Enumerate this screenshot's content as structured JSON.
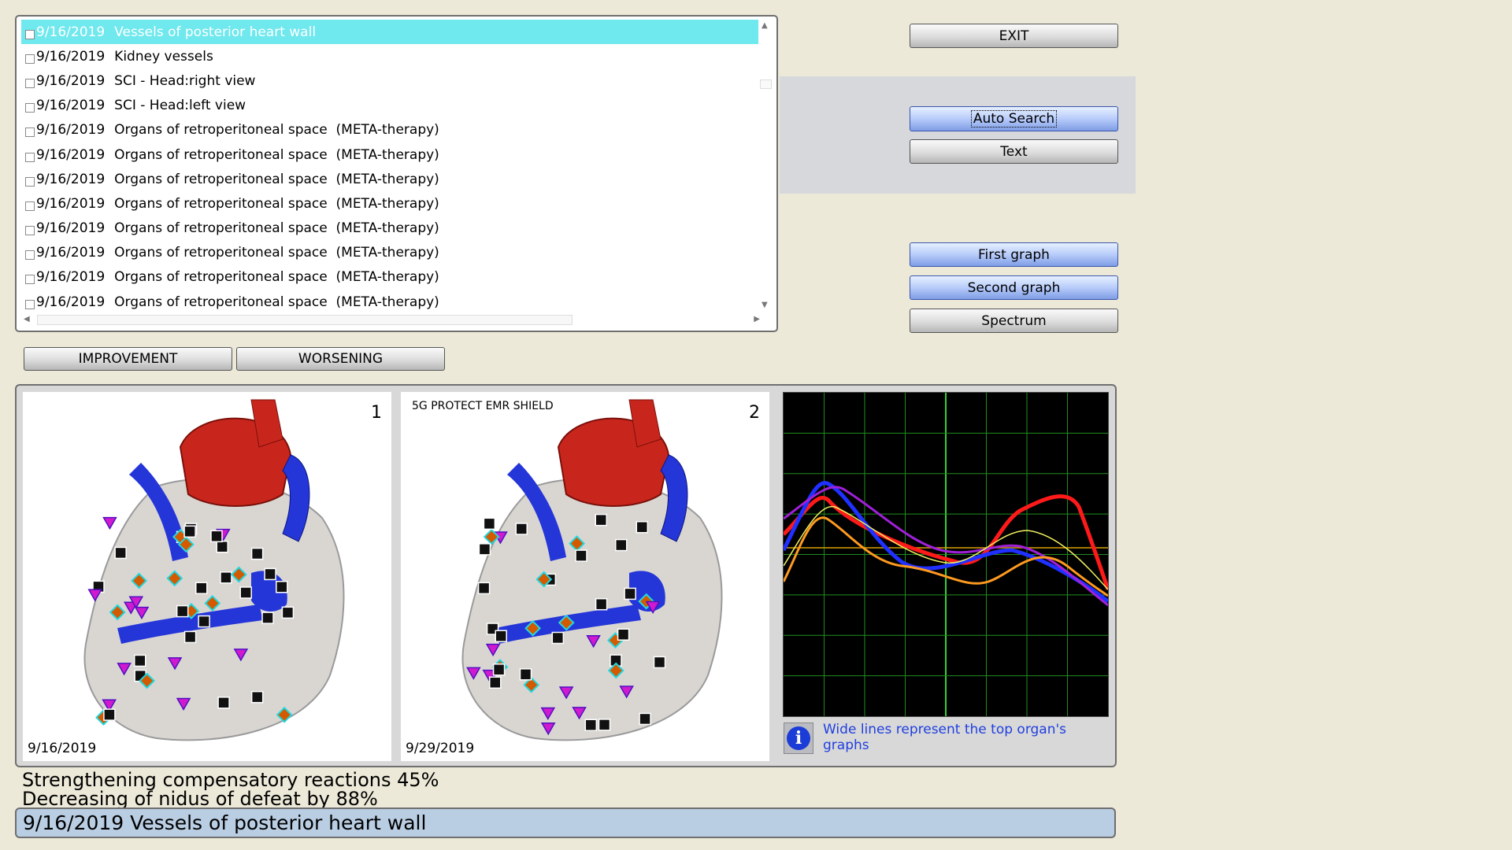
{
  "session_list": {
    "items": [
      {
        "date": "9/16/2019",
        "name": "Vessels of posterior heart wall",
        "selected": true
      },
      {
        "date": "9/16/2019",
        "name": "Kidney vessels"
      },
      {
        "date": "9/16/2019",
        "name": "SCI - Head:right view"
      },
      {
        "date": "9/16/2019",
        "name": "SCI - Head:left view"
      },
      {
        "date": "9/16/2019",
        "name": "Organs of retroperitoneal space  (META-therapy)"
      },
      {
        "date": "9/16/2019",
        "name": "Organs of retroperitoneal space  (META-therapy)"
      },
      {
        "date": "9/16/2019",
        "name": "Organs of retroperitoneal space  (META-therapy)"
      },
      {
        "date": "9/16/2019",
        "name": "Organs of retroperitoneal space  (META-therapy)"
      },
      {
        "date": "9/16/2019",
        "name": "Organs of retroperitoneal space  (META-therapy)"
      },
      {
        "date": "9/16/2019",
        "name": "Organs of retroperitoneal space  (META-therapy)"
      },
      {
        "date": "9/16/2019",
        "name": "Organs of retroperitoneal space  (META-therapy)"
      },
      {
        "date": "9/16/2019",
        "name": "Organs of retroperitoneal space  (META-therapy)"
      }
    ]
  },
  "buttons": {
    "exit": "EXIT",
    "auto_search": "Auto Search",
    "text": "Text",
    "first_graph": "First graph",
    "second_graph": "Second graph",
    "spectrum": "Spectrum",
    "improvement": "IMPROVEMENT",
    "worsening": "WORSENING"
  },
  "images": {
    "first": {
      "number": "1",
      "date": "9/16/2019"
    },
    "second": {
      "number": "2",
      "date": "9/29/2019",
      "caption": "5G PROTECT EMR SHIELD"
    }
  },
  "graph": {
    "info_text": "Wide lines represent the top organ's graphs",
    "colors": {
      "background": "#000000",
      "grid": "#1f8f1f",
      "center": "#38d038",
      "baseline": "#d8a000"
    },
    "series_colors": [
      "#ff1a1a",
      "#2030ff",
      "#a020d8",
      "#ff9a20",
      "#f0f060"
    ]
  },
  "results": {
    "line1": "Strengthening compensatory reactions 45%",
    "line2": "Decreasing of nidus of defeat by 88%"
  },
  "status": {
    "text": "9/16/2019 Vessels of posterior heart wall"
  },
  "colors": {
    "window_bg": "#ece9d8",
    "selection": "#6fe8ee",
    "status_bar": "#b9cde3",
    "blue_button": "#b8ccfa"
  }
}
